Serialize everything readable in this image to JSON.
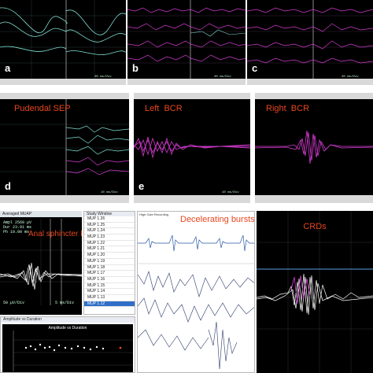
{
  "panels": {
    "a": {
      "label": "a",
      "scale": "20 ms/Div"
    },
    "b": {
      "label": "b",
      "scale": "20 ms/Div"
    },
    "c": {
      "label": "c",
      "scale": "20 ms/Div"
    },
    "d": {
      "label": "d",
      "title": "Pudendal SEP",
      "scale": "10 ms/Div"
    },
    "e": {
      "label": "e",
      "title": "Left  BCR",
      "scale": "10 ms/Div"
    },
    "f": {
      "title": "Right  BCR"
    },
    "muap": {
      "window_title": "Averaged MUAP",
      "stats": [
        "Ampl 2560 µV",
        "Dur 23.91 ms",
        "Ph 10.00 ms"
      ],
      "title": "Anal sphincter EMG",
      "scale_left": "50 µV/Div",
      "scale_right": "5 ms/Div"
    },
    "study": {
      "title": "Study Window",
      "items": [
        "MUP 1.26",
        "MUP 1.25",
        "MUP 1.24",
        "MUP 1.23",
        "MUP 1.22",
        "MUP 1.21",
        "MUP 1.20",
        "MUP 1.19",
        "MUP 1.18",
        "MUP 1.17",
        "MUP 1.16",
        "MUP 1.15",
        "MUP 1.14",
        "MUP 1.13",
        "MUP 1.12"
      ],
      "selected_index": 14
    },
    "amp": {
      "window_title": "Amplitude vs Duration",
      "plot_title": "Amplitude vs Duration"
    },
    "bursts": {
      "title": "Decelerating bursts",
      "header": "High Gain Recording"
    },
    "crds": {
      "title": "CRDs"
    }
  },
  "colors": {
    "panel_bg": "#000000",
    "trace_cyan": "#7fe0d4",
    "trace_magenta": "#d43bd0",
    "title_red": "#e8461e",
    "white": "#ffffff"
  }
}
